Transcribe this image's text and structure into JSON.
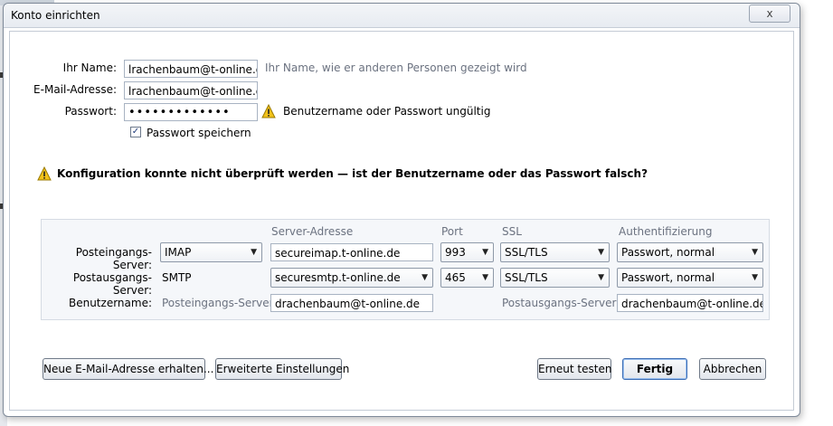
{
  "window": {
    "title": "Konto einrichten",
    "close_label": "x"
  },
  "identity": {
    "name_label": "Ihr Name:",
    "name_value": "lrachenbaum@t-online.de",
    "name_hint": "Ihr Name, wie er anderen Personen gezeigt wird",
    "email_label": "E-Mail-Adresse:",
    "email_value": "lrachenbaum@t-online.de",
    "password_label": "Passwort:",
    "password_value": "•••••••••••••",
    "password_warning": "Benutzername oder Passwort ungültig",
    "remember_label": "Passwort speichern",
    "remember_checked": true
  },
  "alert": {
    "message": "Konfiguration konnte nicht überprüft werden — ist der Benutzername oder das Passwort falsch?"
  },
  "server": {
    "headers": {
      "address": "Server-Adresse",
      "port": "Port",
      "ssl": "SSL",
      "auth": "Authentifizierung"
    },
    "incoming": {
      "label": "Posteingangs-Server:",
      "protocol": "IMAP",
      "address": "secureimap.t-online.de",
      "port": "993",
      "ssl": "SSL/TLS",
      "auth": "Passwort, normal"
    },
    "outgoing": {
      "label": "Postausgangs-Server:",
      "protocol": "SMTP",
      "address": "securesmtp.t-online.de",
      "port": "465",
      "ssl": "SSL/TLS",
      "auth": "Passwort, normal"
    },
    "username": {
      "label": "Benutzername:",
      "incoming_label": "Posteingangs-Server:",
      "incoming_value": "drachenbaum@t-online.de",
      "outgoing_label": "Postausgangs-Server:",
      "outgoing_value": "drachenbaum@t-online.de"
    }
  },
  "buttons": {
    "new_address": "Neue E-Mail-Adresse erhalten...",
    "advanced": "Erweiterte Einstellungen",
    "retest": "Erneut testen",
    "done": "Fertig",
    "cancel": "Abbrechen"
  },
  "colors": {
    "window_border": "#7f8a99",
    "default_button_border": "#3a6bb3",
    "warning_yellow": "#f2c21a"
  }
}
